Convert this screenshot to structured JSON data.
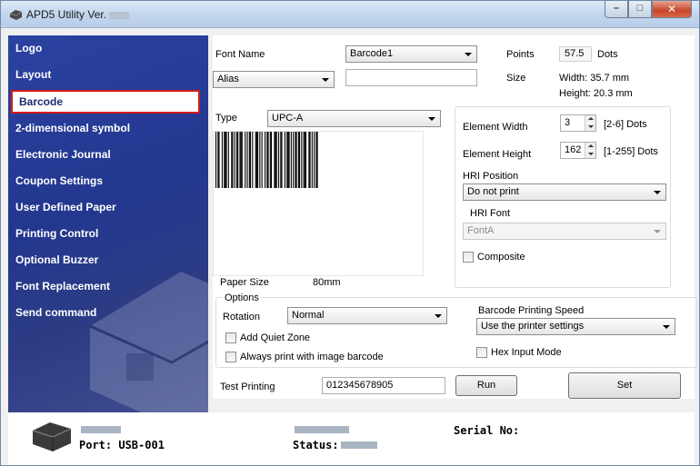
{
  "window": {
    "title": "APD5 Utility Ver.",
    "minimize": "–",
    "maximize": "□",
    "close": "✕"
  },
  "sidebar": {
    "items": [
      {
        "label": "Logo"
      },
      {
        "label": "Layout"
      },
      {
        "label": "Barcode",
        "active": true
      },
      {
        "label": "2-dimensional symbol"
      },
      {
        "label": "Electronic Journal"
      },
      {
        "label": "Coupon Settings"
      },
      {
        "label": "User Defined Paper"
      },
      {
        "label": "Printing Control"
      },
      {
        "label": "Optional Buzzer"
      },
      {
        "label": "Font Replacement"
      },
      {
        "label": "Send command"
      }
    ]
  },
  "font": {
    "name_label": "Font Name",
    "name_value": "Barcode1",
    "alias_value": "Alias",
    "alias_text": "",
    "points_label": "Points",
    "points_value": "57.5",
    "points_unit": "Dots",
    "size_label": "Size",
    "width": "Width: 35.7 mm",
    "height": "Height: 20.3 mm"
  },
  "barcode": {
    "type_label": "Type",
    "type_value": "UPC-A",
    "element_width_label": "Element Width",
    "element_width_value": "3",
    "element_width_range": "[2-6] Dots",
    "element_height_label": "Element Height",
    "element_height_value": "162",
    "element_height_range": "[1-255] Dots",
    "hri_position_label": "HRI Position",
    "hri_position_value": "Do not print",
    "hri_font_label": "HRI Font",
    "hri_font_value": "FontA",
    "composite_label": "Composite",
    "paper_size_label": "Paper Size",
    "paper_size_value": "80mm"
  },
  "options": {
    "title": "Options",
    "rotation_label": "Rotation",
    "rotation_value": "Normal",
    "quiet_zone_label": "Add Quiet Zone",
    "image_barcode_label": "Always print with image barcode",
    "speed_label": "Barcode Printing Speed",
    "speed_value": "Use the printer settings",
    "hex_label": "Hex Input Mode"
  },
  "test": {
    "label": "Test Printing",
    "value": "012345678905",
    "run": "Run",
    "set": "Set"
  },
  "footer": {
    "port": "Port: USB-001",
    "status": "Status:",
    "serial": "Serial No:"
  }
}
